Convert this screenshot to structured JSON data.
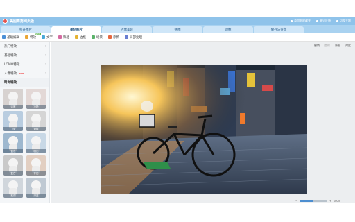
{
  "app": {
    "title": "美图秀秀网页版",
    "links": [
      "添加到收藏夹",
      "意见反馈",
      "切换主题"
    ]
  },
  "tabs": [
    {
      "label": "打开图片",
      "active": false
    },
    {
      "label": "美化图片",
      "active": true
    },
    {
      "label": "人像美容",
      "active": false
    },
    {
      "label": "拼图",
      "active": false
    },
    {
      "label": "边框",
      "active": false
    },
    {
      "label": "保存与分享",
      "active": false
    }
  ],
  "toolbar": {
    "items": [
      {
        "label": "基础编辑",
        "icon": "edit-icon",
        "color": "#4a8fd6"
      },
      {
        "label": "特效",
        "icon": "magic-icon",
        "color": "#e9a636",
        "badge": "NEW"
      },
      {
        "label": "文字",
        "icon": "text-icon",
        "color": "#49a9d8"
      },
      {
        "label": "饰品",
        "icon": "sticker-icon",
        "color": "#d46aa0"
      },
      {
        "label": "边框",
        "icon": "frame-icon",
        "color": "#e5b333"
      },
      {
        "label": "场景",
        "icon": "scene-icon",
        "color": "#5bb36a"
      },
      {
        "label": "涂鸦",
        "icon": "brush-icon",
        "color": "#e7673f"
      },
      {
        "label": "局部处理",
        "icon": "local-icon",
        "color": "#6a7fd1"
      }
    ]
  },
  "sidebar": {
    "categories": [
      {
        "label": "热门特效"
      },
      {
        "label": "基础特效"
      },
      {
        "label": "LOMO特效"
      },
      {
        "label": "人像特效",
        "hot": "HOT"
      }
    ],
    "section_title": "时尚特效",
    "effects": [
      "淡雅",
      "冷艳",
      "飞雪",
      "哥特",
      "蓝色",
      "暖化",
      "复古",
      "怀旧",
      "紫调",
      "深蓝"
    ]
  },
  "actions": {
    "items": [
      "撤销",
      "重做",
      "原图",
      "对比"
    ]
  },
  "zoom": {
    "label": "100%",
    "level": 0.5
  },
  "colors": {
    "titlebar": "#8fc3ea",
    "tabsbar": "#a9d2f0",
    "accent": "#4d8ed0"
  }
}
